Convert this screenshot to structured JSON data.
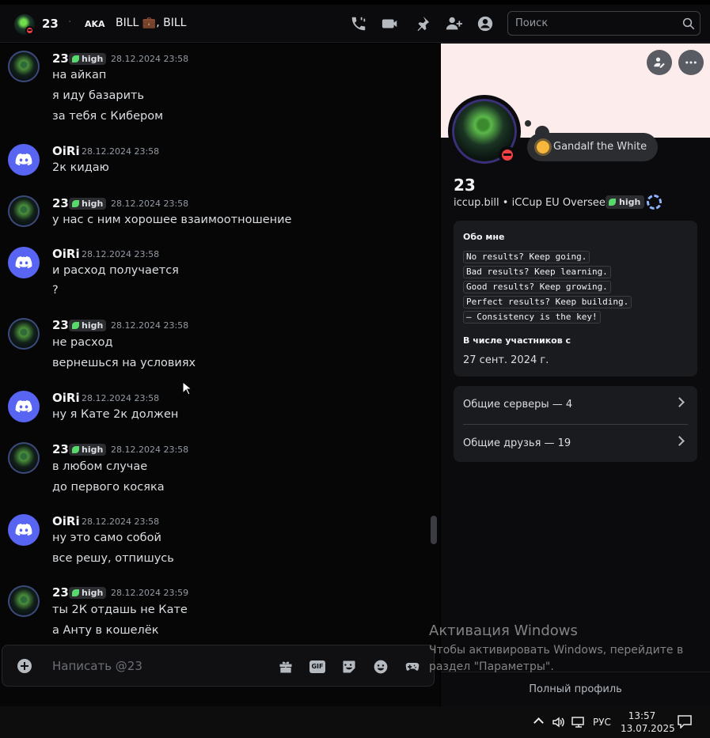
{
  "header": {
    "name": "23",
    "separator": "·",
    "aka_label": "AKA",
    "aka_names": "BILL 💼, BILL",
    "search_placeholder": "Поиск"
  },
  "messages": [
    {
      "author": "23",
      "tag": "high",
      "time": "28.12.2024 23:58",
      "lines": [
        "на айкап",
        "я иду базарить",
        "за тебя с Кибером"
      ]
    },
    {
      "author": "OiRi",
      "time": "28.12.2024 23:58",
      "lines": [
        "2к кидаю"
      ]
    },
    {
      "author": "23",
      "tag": "high",
      "time": "28.12.2024 23:58",
      "lines": [
        "у нас с ним хорошее взаимоотношение"
      ]
    },
    {
      "author": "OiRi",
      "time": "28.12.2024 23:58",
      "lines": [
        "и расход получается",
        "?"
      ]
    },
    {
      "author": "23",
      "tag": "high",
      "time": "28.12.2024 23:58",
      "lines": [
        "не расход",
        "вернешься на условиях"
      ]
    },
    {
      "author": "OiRi",
      "time": "28.12.2024 23:58",
      "lines": [
        "ну я Кате 2к должен"
      ]
    },
    {
      "author": "23",
      "tag": "high",
      "time": "28.12.2024 23:58",
      "lines": [
        "в любом случае",
        "до первого косяка"
      ]
    },
    {
      "author": "OiRi",
      "time": "28.12.2024 23:58",
      "lines": [
        "ну это само собой",
        "все решу, отпишусь"
      ]
    },
    {
      "author": "23",
      "tag": "high",
      "time": "28.12.2024 23:59",
      "lines": [
        "ты 2К отдашь не Кате",
        "а Анту в кошелёк"
      ]
    }
  ],
  "composer": {
    "placeholder": "Написать @23",
    "gif_label": "GIF"
  },
  "profile": {
    "status_text": "Gandalf the White",
    "display_name": "23",
    "username": "iccup.bill",
    "bullet": "•",
    "pronouns": "iCCup EU Overseer",
    "tag": "high",
    "about_heading": "Обо мне",
    "about_lines": [
      "No results? Keep going.",
      "Bad results? Keep learning.",
      "Good results? Keep growing.",
      "Perfect results? Keep building.",
      "— Consistency is the key!"
    ],
    "member_since_heading": "В числе участников с",
    "member_since": "27 сент. 2024 г.",
    "mutual_servers": "Общие серверы — 4",
    "mutual_friends": "Общие друзья — 19",
    "full_profile": "Полный профиль"
  },
  "watermark": {
    "title": "Активация Windows",
    "subtitle": "Чтобы активировать Windows, перейдите в раздел \"Параметры\"."
  },
  "taskbar": {
    "language": "РУС",
    "time": "13:57",
    "date": "13.07.2025"
  },
  "colors": {
    "discord_blurple": "#5865f2",
    "dnd_red": "#f23f43",
    "banner": "#fdecec",
    "tag_leaf": "#57d96b"
  }
}
